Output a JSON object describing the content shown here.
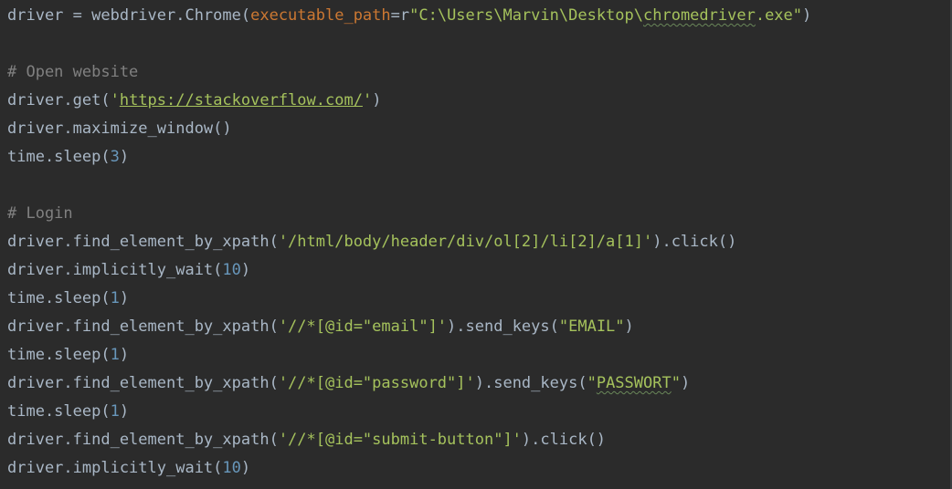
{
  "editor": {
    "language": "python",
    "colors": {
      "background": "#2b2b2b",
      "default": "#a9b7c6",
      "string": "#a5c25c",
      "number": "#6897bb",
      "comment": "#808080",
      "parameter": "#cc7832"
    },
    "lines": [
      {
        "tokens": [
          {
            "text": "driver = webdriver.Chrome(",
            "type": "default"
          },
          {
            "text": "executable_path",
            "type": "param"
          },
          {
            "text": "=r",
            "type": "default"
          },
          {
            "text": "\"C:\\Users\\Marvin\\Desktop\\",
            "type": "string"
          },
          {
            "text": "chromedriver",
            "type": "string",
            "typo": true
          },
          {
            "text": ".exe\"",
            "type": "string"
          },
          {
            "text": ")",
            "type": "default"
          }
        ]
      },
      {
        "tokens": []
      },
      {
        "tokens": [
          {
            "text": "# Open website",
            "type": "comment"
          }
        ]
      },
      {
        "tokens": [
          {
            "text": "driver.get(",
            "type": "default"
          },
          {
            "text": "'",
            "type": "string"
          },
          {
            "text": "https://stackoverflow.com/",
            "type": "link"
          },
          {
            "text": "'",
            "type": "string"
          },
          {
            "text": ")",
            "type": "default"
          }
        ]
      },
      {
        "tokens": [
          {
            "text": "driver.maximize_window()",
            "type": "default"
          }
        ]
      },
      {
        "tokens": [
          {
            "text": "time.sleep(",
            "type": "default"
          },
          {
            "text": "3",
            "type": "number"
          },
          {
            "text": ")",
            "type": "default"
          }
        ]
      },
      {
        "tokens": []
      },
      {
        "tokens": [
          {
            "text": "# Login",
            "type": "comment"
          }
        ]
      },
      {
        "tokens": [
          {
            "text": "driver.find_element_by_xpath(",
            "type": "default"
          },
          {
            "text": "'/html/body/header/div/ol[2]/li[2]/a[1]'",
            "type": "string"
          },
          {
            "text": ").click()",
            "type": "default"
          }
        ]
      },
      {
        "tokens": [
          {
            "text": "driver.implicitly_wait(",
            "type": "default"
          },
          {
            "text": "10",
            "type": "number"
          },
          {
            "text": ")",
            "type": "default"
          }
        ]
      },
      {
        "tokens": [
          {
            "text": "time.sleep(",
            "type": "default"
          },
          {
            "text": "1",
            "type": "number"
          },
          {
            "text": ")",
            "type": "default"
          }
        ]
      },
      {
        "tokens": [
          {
            "text": "driver.find_element_by_xpath(",
            "type": "default"
          },
          {
            "text": "'//*[@id=\"email\"]'",
            "type": "string"
          },
          {
            "text": ").send_keys(",
            "type": "default"
          },
          {
            "text": "\"EMAIL\"",
            "type": "string"
          },
          {
            "text": ")",
            "type": "default"
          }
        ]
      },
      {
        "tokens": [
          {
            "text": "time.sleep(",
            "type": "default"
          },
          {
            "text": "1",
            "type": "number"
          },
          {
            "text": ")",
            "type": "default"
          }
        ]
      },
      {
        "tokens": [
          {
            "text": "driver.find_element_by_xpath(",
            "type": "default"
          },
          {
            "text": "'//*[@id=\"password\"]'",
            "type": "string"
          },
          {
            "text": ").send_keys(",
            "type": "default"
          },
          {
            "text": "\"",
            "type": "string"
          },
          {
            "text": "PASSWORT",
            "type": "string",
            "typo": true
          },
          {
            "text": "\"",
            "type": "string"
          },
          {
            "text": ")",
            "type": "default"
          }
        ]
      },
      {
        "tokens": [
          {
            "text": "time.sleep(",
            "type": "default"
          },
          {
            "text": "1",
            "type": "number"
          },
          {
            "text": ")",
            "type": "default"
          }
        ]
      },
      {
        "tokens": [
          {
            "text": "driver.find_element_by_xpath(",
            "type": "default"
          },
          {
            "text": "'//*[@id=\"submit-button\"]'",
            "type": "string"
          },
          {
            "text": ").click()",
            "type": "default"
          }
        ]
      },
      {
        "tokens": [
          {
            "text": "driver.implicitly_wait(",
            "type": "default"
          },
          {
            "text": "10",
            "type": "number"
          },
          {
            "text": ")",
            "type": "default"
          }
        ]
      }
    ]
  }
}
